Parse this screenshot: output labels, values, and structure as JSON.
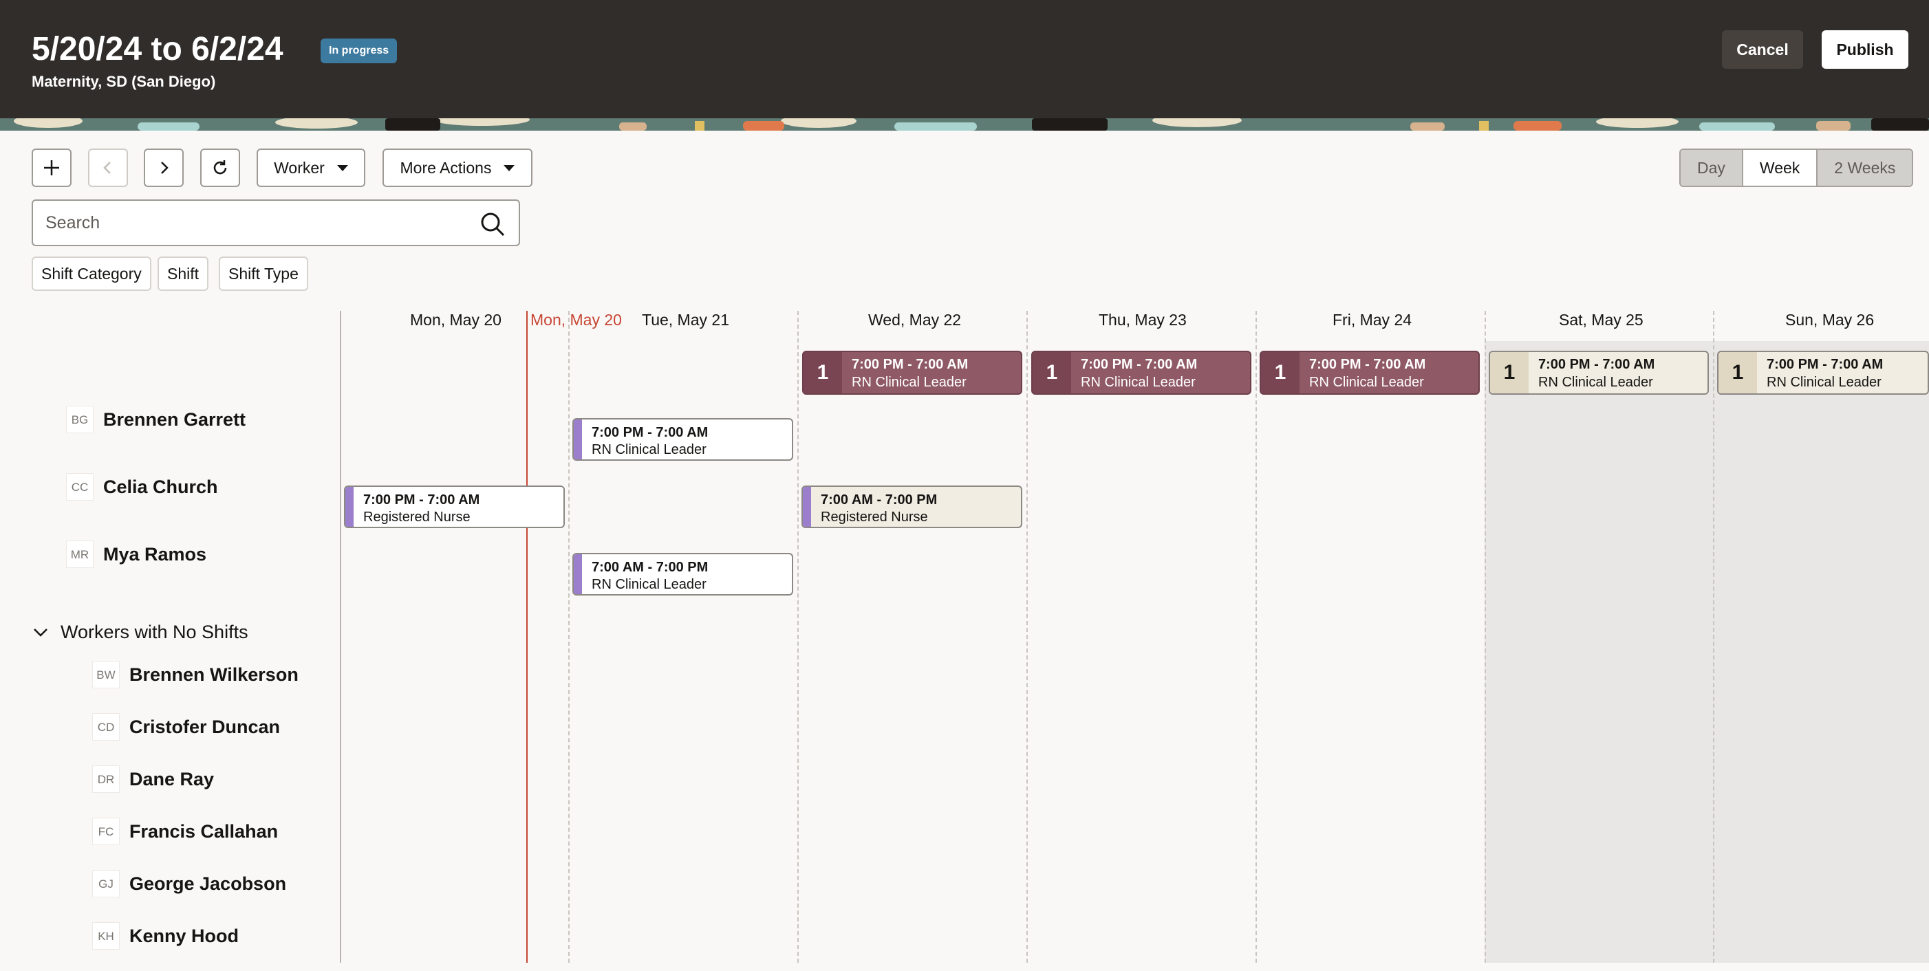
{
  "header": {
    "title": "5/20/24 to 6/2/24",
    "status": "In progress",
    "subtitle": "Maternity, SD (San Diego)",
    "cancel_label": "Cancel",
    "publish_label": "Publish"
  },
  "toolbar": {
    "worker_label": "Worker",
    "more_actions_label": "More Actions",
    "views": [
      "Day",
      "Week",
      "2 Weeks"
    ],
    "selected_view": "Week"
  },
  "search": {
    "placeholder": "Search"
  },
  "filters": [
    "Shift Category",
    "Shift",
    "Shift Type"
  ],
  "days": [
    "Mon, May 20",
    "Mon, May 20",
    "Tue, May 21",
    "Wed, May 22",
    "Thu, May 23",
    "Fri, May 24",
    "Sat, May 25",
    "Sun, May 26"
  ],
  "open_shifts": [
    {
      "count": "1",
      "time": "7:00 PM - 7:00 AM",
      "role": "RN Clinical Leader"
    },
    {
      "count": "1",
      "time": "7:00 PM - 7:00 AM",
      "role": "RN Clinical Leader"
    },
    {
      "count": "1",
      "time": "7:00 PM - 7:00 AM",
      "role": "RN Clinical Leader"
    },
    {
      "count": "1",
      "time": "7:00 PM - 7:00 AM",
      "role": "RN Clinical Leader"
    },
    {
      "count": "1",
      "time": "7:00 PM - 7:00 AM",
      "role": "RN Clinical Leader"
    }
  ],
  "workers": [
    {
      "initials": "BG",
      "name": "Brennen Garrett"
    },
    {
      "initials": "CC",
      "name": "Celia Church"
    },
    {
      "initials": "MR",
      "name": "Mya Ramos"
    }
  ],
  "shifts": [
    {
      "time": "7:00 PM - 7:00 AM",
      "role": "RN Clinical Leader"
    },
    {
      "time": "7:00 PM - 7:00 AM",
      "role": "Registered Nurse"
    },
    {
      "time": "7:00 AM - 7:00 PM",
      "role": "Registered Nurse"
    },
    {
      "time": "7:00 AM - 7:00 PM",
      "role": "RN Clinical Leader"
    }
  ],
  "no_shifts_section": {
    "label": "Workers with No Shifts",
    "workers": [
      {
        "initials": "BW",
        "name": "Brennen Wilkerson"
      },
      {
        "initials": "CD",
        "name": "Cristofer Duncan"
      },
      {
        "initials": "DR",
        "name": "Dane Ray"
      },
      {
        "initials": "FC",
        "name": "Francis Callahan"
      },
      {
        "initials": "GJ",
        "name": "George Jacobson"
      },
      {
        "initials": "KH",
        "name": "Kenny Hood"
      }
    ]
  },
  "colors": {
    "header_bg": "#312d2a",
    "status_badge": "#3c7aa0",
    "today_line": "#c74634",
    "open_shift": "#8f5966",
    "shift_accent": "#9b7fcc"
  }
}
